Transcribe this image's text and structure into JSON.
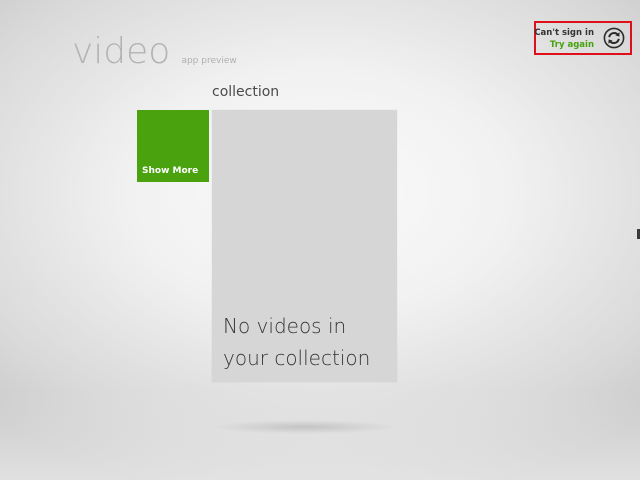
{
  "app": {
    "title": "video",
    "subtitle": "app preview"
  },
  "collection": {
    "heading": "collection",
    "show_more_label": "Show More",
    "empty_line1": "No videos in",
    "empty_line2": "your collection"
  },
  "signin": {
    "status_text": "Can't sign in",
    "action_text": "Try again",
    "icon": "refresh-icon"
  },
  "colors": {
    "accent_green": "#4aa30e",
    "error_border": "#e0101a",
    "action_green": "#44a30c"
  }
}
